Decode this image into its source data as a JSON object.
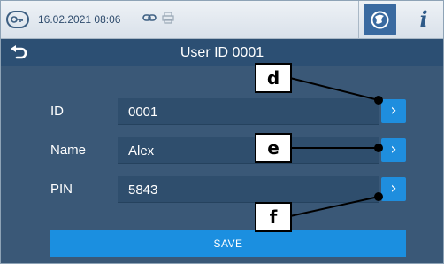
{
  "status_bar": {
    "datetime": "16.02.2021 08:06",
    "icons": [
      "lock-icon",
      "link-icon",
      "printer-icon",
      "logo-icon",
      "info-icon"
    ],
    "info_label": "i"
  },
  "header": {
    "title": "User ID 0001",
    "back_icon": "back-arrow-icon"
  },
  "form": {
    "rows": [
      {
        "label": "ID",
        "value": "0001",
        "button_glyph": "›"
      },
      {
        "label": "Name",
        "value": "Alex",
        "button_glyph": "›"
      },
      {
        "label": "PIN",
        "value": "5843",
        "button_glyph": "›"
      }
    ],
    "save_label": "SAVE"
  },
  "annotations": [
    {
      "letter": "d"
    },
    {
      "letter": "e"
    },
    {
      "letter": "f"
    }
  ],
  "colors": {
    "screen_bg": "#3a5877",
    "titlebar_bg": "#2c4f73",
    "accent_button": "#1f8ede",
    "status_bar_bg": "#e4eaf0"
  }
}
